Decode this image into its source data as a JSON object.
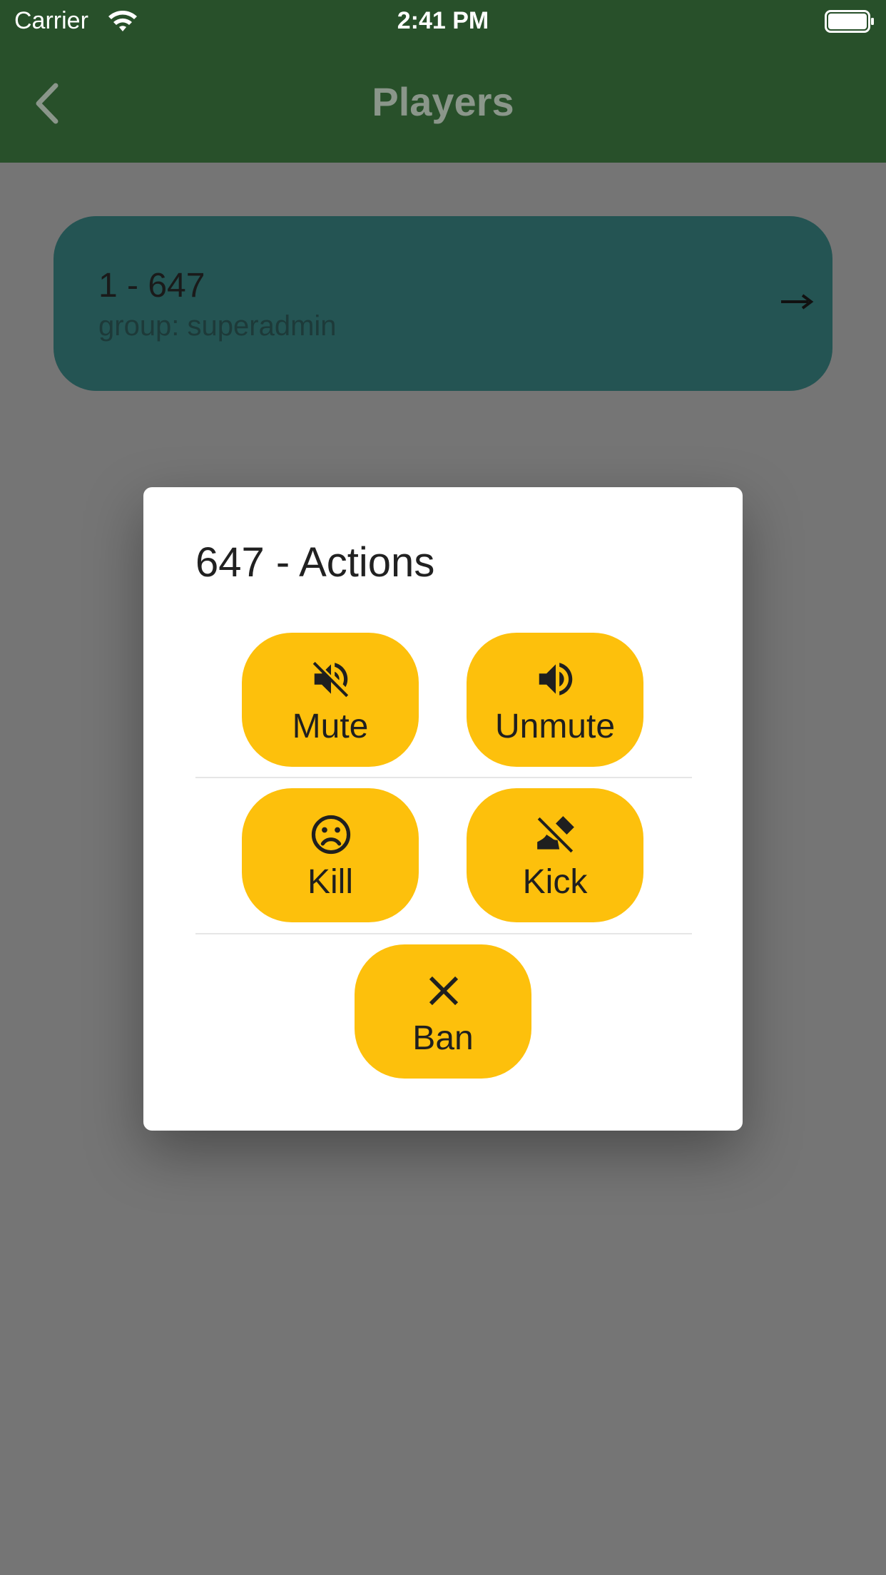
{
  "status_bar": {
    "carrier": "Carrier",
    "time": "2:41 PM"
  },
  "app_bar": {
    "title": "Players"
  },
  "player": {
    "name": "1 - 647",
    "group": "group: superadmin"
  },
  "dialog": {
    "title": "647 - Actions",
    "actions": {
      "mute": {
        "label": "Mute",
        "icon": "volume-off-icon"
      },
      "unmute": {
        "label": "Unmute",
        "icon": "volume-up-icon"
      },
      "kill": {
        "label": "Kill",
        "icon": "sad-face-icon"
      },
      "kick": {
        "label": "Kick",
        "icon": "kick-off-icon"
      },
      "ban": {
        "label": "Ban",
        "icon": "close-icon"
      }
    }
  },
  "colors": {
    "app_bar": "#28502a",
    "card": "#245453",
    "action_button": "#fdc00c",
    "scrim": "#757575"
  }
}
